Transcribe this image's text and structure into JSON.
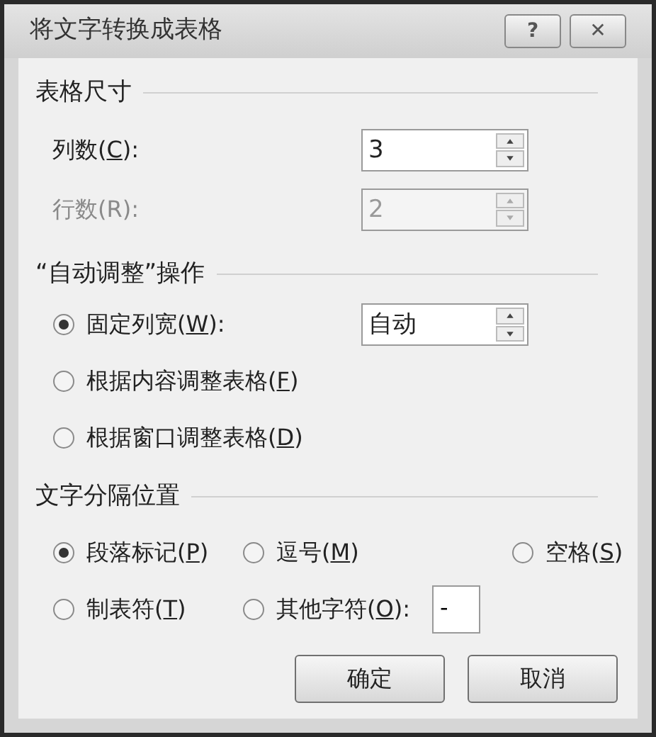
{
  "window": {
    "title": "将文字转换成表格",
    "buttons": [
      "?",
      "✕"
    ]
  },
  "table_size": {
    "heading": "表格尺寸",
    "fields": [
      {
        "before": "列数(",
        "key": "C",
        "after": "):",
        "value": "3",
        "disabled": false
      },
      {
        "before": "行数(",
        "key": "R",
        "after": "):",
        "value": "2",
        "disabled": true
      }
    ]
  },
  "autofit": {
    "heading": "“自动调整”操作",
    "options": [
      {
        "before": "固定列宽(",
        "key": "W",
        "after": "):",
        "selected": true,
        "value": "自动"
      },
      {
        "before": "根据内容调整表格(",
        "key": "F",
        "after": ")",
        "selected": false
      },
      {
        "before": "根据窗口调整表格(",
        "key": "D",
        "after": ")",
        "selected": false
      }
    ]
  },
  "separator": {
    "heading": "文字分隔位置",
    "options": [
      {
        "before": "段落标记(",
        "key": "P",
        "after": ")",
        "selected": true
      },
      {
        "before": "逗号(",
        "key": "M",
        "after": ")",
        "selected": false
      },
      {
        "before": "空格(",
        "key": "S",
        "after": ")",
        "selected": false
      },
      {
        "before": "制表符(",
        "key": "T",
        "after": ")",
        "selected": false
      },
      {
        "before": "其他字符(",
        "key": "O",
        "after": "):",
        "selected": false,
        "value": "-"
      }
    ]
  },
  "buttons": [
    "确定",
    "取消"
  ]
}
